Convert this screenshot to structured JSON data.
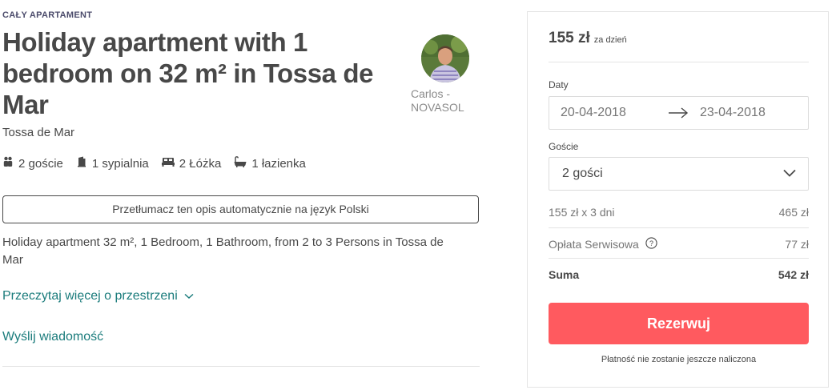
{
  "listing": {
    "kicker": "CAŁY APARTAMENT",
    "title": "Holiday apartment with 1 bedroom on 32 m² in Tossa de Mar",
    "city": "Tossa de Mar",
    "host_name": "Carlos - NOVASOL",
    "amenities": [
      {
        "icon": "guests-icon",
        "label": "2 goście"
      },
      {
        "icon": "bedroom-icon",
        "label": "1 sypialnia"
      },
      {
        "icon": "bed-icon",
        "label": "2 Łóżka"
      },
      {
        "icon": "bathtub-icon",
        "label": "1 łazienka"
      }
    ],
    "translate_label": "Przetłumacz ten opis automatycznie na język Polski",
    "description": "Holiday apartment 32 m², 1 Bedroom, 1 Bathroom, from 2 to 3 Persons in Tossa de Mar",
    "read_more_label": "Przeczytaj więcej o przestrzeni",
    "message_label": "Wyślij wiadomość"
  },
  "booking": {
    "price": "155 zł",
    "per": "za dzień",
    "dates_label": "Daty",
    "check_in": "20-04-2018",
    "check_out": "23-04-2018",
    "guests_label": "Goście",
    "guests_value": "2 gości",
    "line_nights_label": "155 zł x 3 dni",
    "line_nights_value": "465 zł",
    "service_fee_label": "Opłata Serwisowa",
    "service_fee_value": "77 zł",
    "total_label": "Suma",
    "total_value": "542 zł",
    "reserve_label": "Rezerwuj",
    "charge_note": "Płatność nie zostanie jeszcze naliczona"
  },
  "colors": {
    "accent": "#ff5a5f",
    "link": "#1b7c7c",
    "text": "#484848"
  }
}
